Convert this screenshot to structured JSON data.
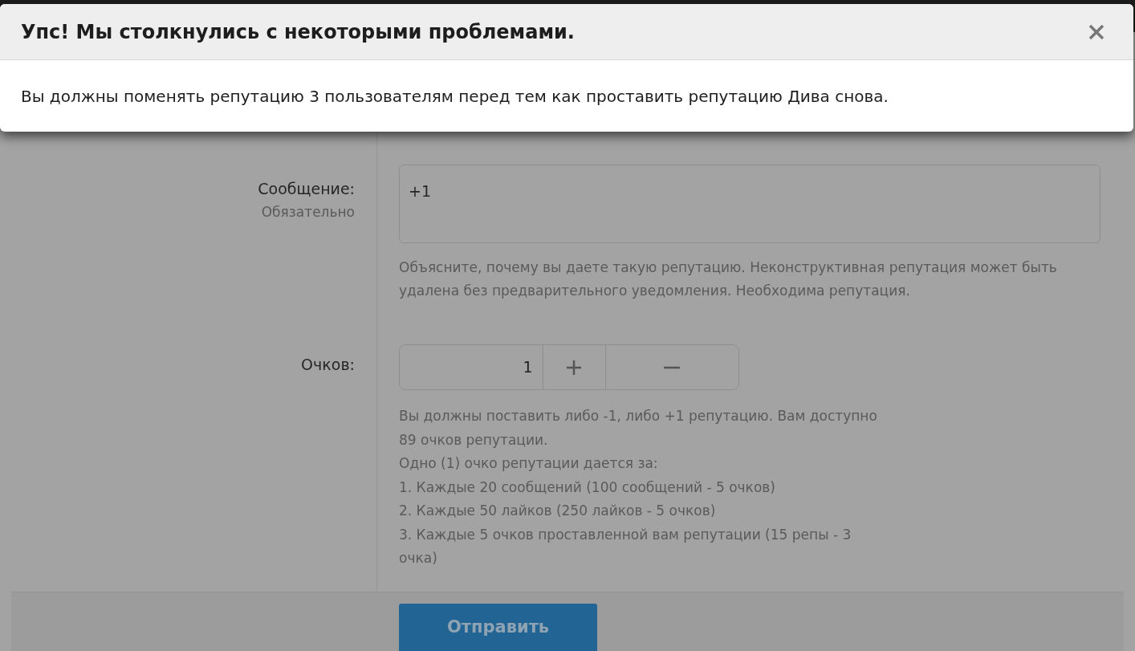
{
  "modal": {
    "title": "Упс! Мы столкнулись с некоторыми проблемами.",
    "message": "Вы должны поменять репутацию 3 пользователям перед тем как проставить репутацию Дива снова."
  },
  "form": {
    "message_field": {
      "label": "Сообщение:",
      "note": "Обязательно",
      "value": "+1",
      "hint": "Объясните, почему вы даете такую репутацию. Неконструктивная репутация может быть удалена без предварительного уведомления. Необходима репутация."
    },
    "points_field": {
      "label": "Очков:",
      "value": "1",
      "hint_lines": [
        "Вы должны поставить либо -1, либо +1 репутацию. Вам доступно 89 очков репутации.",
        "Одно (1) очко репутации дается за:",
        "1. Каждые 20 сообщений (100 сообщений - 5 очков)",
        "2. Каждые 50 лайков (250 лайков - 5 очков)",
        "3. Каждые 5 очков проставленной вам репутации (15 репы - 3 очка)"
      ]
    },
    "submit": "Отправить"
  }
}
